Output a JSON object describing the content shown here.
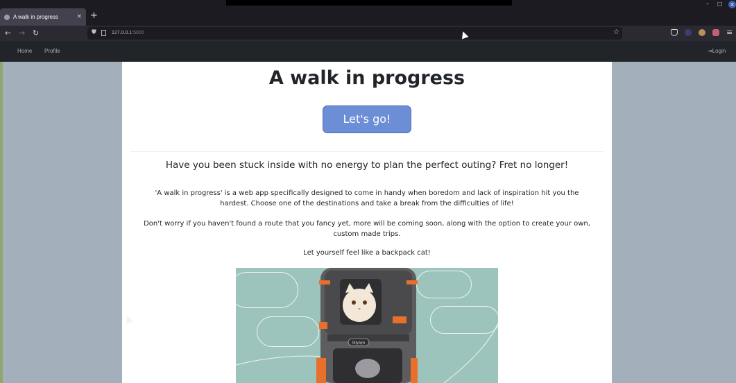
{
  "browser": {
    "tab_title": "A walk in progress",
    "tab_close": "×",
    "new_tab": "+",
    "url_host": "127.0.0.1",
    "url_port": ":5000",
    "window_min": "–",
    "window_max": "□",
    "window_close": "×",
    "back_icon": "←",
    "forward_icon": "→",
    "reload_icon": "↻",
    "star_icon": "☆",
    "menu_icon": "≡"
  },
  "navbar": {
    "home": "Home",
    "profile": "Profile",
    "login": "Login"
  },
  "main": {
    "title": "A walk in progress",
    "cta_label": "Let's go!",
    "lead": "Have you been stuck inside with no energy to plan the perfect outing? Fret no longer!",
    "paragraph1": "'A walk in progress' is a web app specifically designed to come in handy when boredom and lack of inspiration hit you the hardest. Choose one of the destinations and take a break from the difficulties of life!",
    "paragraph2": "Don't worry if you haven't found a route that you fancy yet, more will be coming soon, along with the option to create your own, custom made trips.",
    "paragraph3": "Let yourself feel like a backpack cat!",
    "image_logo_text": "Ibiyaya"
  },
  "colors": {
    "page_bg": "#a3b0bc",
    "navbar_bg": "#212529",
    "cta_bg": "#6c8ed6",
    "image_bg": "#9dc4bc",
    "backpack_gray": "#5d5d60",
    "backpack_orange": "#e8702a"
  },
  "icons": [
    "back-icon",
    "forward-icon",
    "reload-icon",
    "shield-icon",
    "bookmark-star-icon",
    "pocket-icon",
    "menu-icon",
    "login-icon"
  ]
}
